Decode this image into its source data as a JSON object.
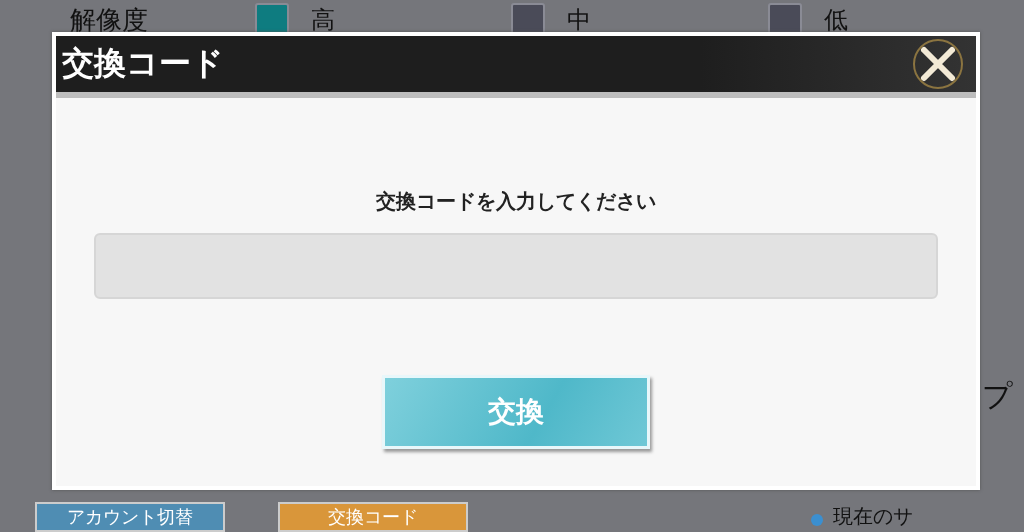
{
  "settings_row": {
    "label": "解像度",
    "options": [
      {
        "label": "高",
        "selected": true
      },
      {
        "label": "中",
        "selected": false
      },
      {
        "label": "低",
        "selected": false
      }
    ]
  },
  "dialog": {
    "title": "交換コード",
    "prompt": "交換コードを入力してください",
    "submit_button": "交換"
  },
  "side_text": "プ",
  "bottom_buttons": [
    {
      "label": "アカウント切替",
      "color": "#4f8db3"
    },
    {
      "label": "交換コード",
      "color": "#d9963a"
    }
  ],
  "server_label": "現在のサ"
}
